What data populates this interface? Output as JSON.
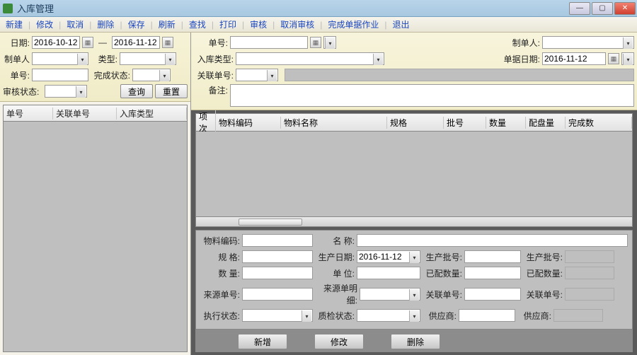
{
  "titlebar": {
    "title": "入库管理"
  },
  "toolbar": {
    "items": [
      "新建",
      "修改",
      "取消",
      "删除",
      "保存",
      "刷新",
      "查找",
      "打印",
      "审核",
      "取消审核",
      "完成单据作业",
      "退出"
    ]
  },
  "left_query": {
    "date_label": "日期:",
    "date_from": "2016-10-12",
    "date_to": "2016-11-12",
    "dash": "—",
    "maker_label": "制单人",
    "type_label": "类型:",
    "billno_label": "单号:",
    "complete_status_label": "完成状态:",
    "audit_status_label": "审核状态:",
    "query_btn": "查询",
    "reset_btn": "重置"
  },
  "right_query": {
    "billno_label": "单号:",
    "maker_label": "制单人:",
    "intype_label": "入库类型:",
    "billdate_label": "单据日期:",
    "billdate_value": "2016-11-12",
    "reldoc_label": "关联单号:",
    "remark_label": "备注:"
  },
  "left_grid": {
    "columns": [
      "单号",
      "关联单号",
      "入库类型"
    ],
    "rows": []
  },
  "right_grid": {
    "columns": [
      "项次",
      "物料编码",
      "物料名称",
      "规格",
      "批号",
      "数量",
      "配盘量",
      "完成数"
    ],
    "rows": []
  },
  "detail": {
    "matcode_label": "物料编码:",
    "name_label": "名    称:",
    "spec_label": "规    格:",
    "proddate_label": "生产日期:",
    "proddate_value": "2016-11-12",
    "prodlot_label": "生产批号:",
    "prodlot_label2": "生产批号:",
    "qty_label": "数    量:",
    "unit_label": "单    位:",
    "allocqty_label": "已配数量:",
    "allocqty_label2": "已配数量:",
    "srcbill_label": "来源单号:",
    "srcdetail_label": "来源单明细:",
    "reldoc_label": "关联单号:",
    "reldoc_label2": "关联单号:",
    "execstatus_label": "执行状态:",
    "inspstatus_label": "质检状态:",
    "supplier_label": "供应商:",
    "supplier_label2": "供应商:"
  },
  "bottom_buttons": {
    "new": "新增",
    "edit": "修改",
    "delete": "删除"
  }
}
